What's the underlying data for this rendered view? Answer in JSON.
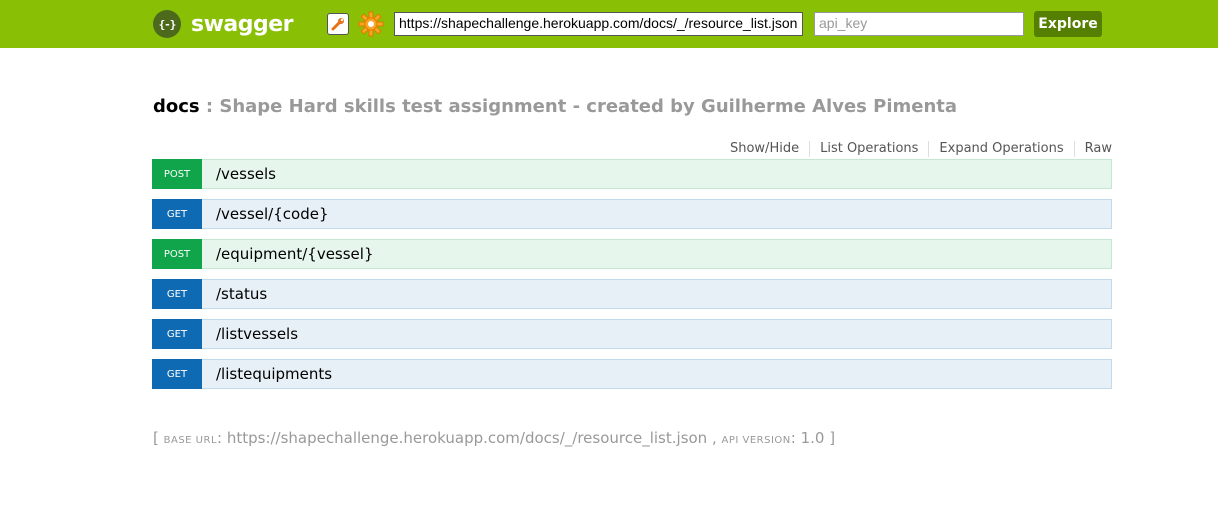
{
  "header": {
    "logo_glyph": "{-}",
    "logo_text": "swagger",
    "url_value": "https://shapechallenge.herokuapp.com/docs/_/resource_list.json",
    "api_key_placeholder": "api_key",
    "explore_label": "Explore",
    "icons": [
      "wrench-icon",
      "gear-icon"
    ],
    "color": "#89bf04"
  },
  "title": {
    "name": "docs",
    "separator": " : ",
    "description": "Shape Hard skills test assignment - created by Guilherme Alves Pimenta"
  },
  "operations_links": [
    "Show/Hide",
    "List Operations",
    "Expand Operations",
    "Raw"
  ],
  "endpoints": [
    {
      "method": "POST",
      "path": "/vessels"
    },
    {
      "method": "GET",
      "path": "/vessel/{code}"
    },
    {
      "method": "POST",
      "path": "/equipment/{vessel}"
    },
    {
      "method": "GET",
      "path": "/status"
    },
    {
      "method": "GET",
      "path": "/listvessels"
    },
    {
      "method": "GET",
      "path": "/listequipments"
    }
  ],
  "footer": {
    "open_bracket": "[ ",
    "base_url_label": "base url",
    "base_url_value": ": https://shapechallenge.herokuapp.com/docs/_/resource_list.json , ",
    "api_version_label": "api version",
    "api_version_value": ": 1.0 ]"
  },
  "colors": {
    "get": "#0f6ab4",
    "post": "#10a54a",
    "explore_button": "#547f00"
  }
}
